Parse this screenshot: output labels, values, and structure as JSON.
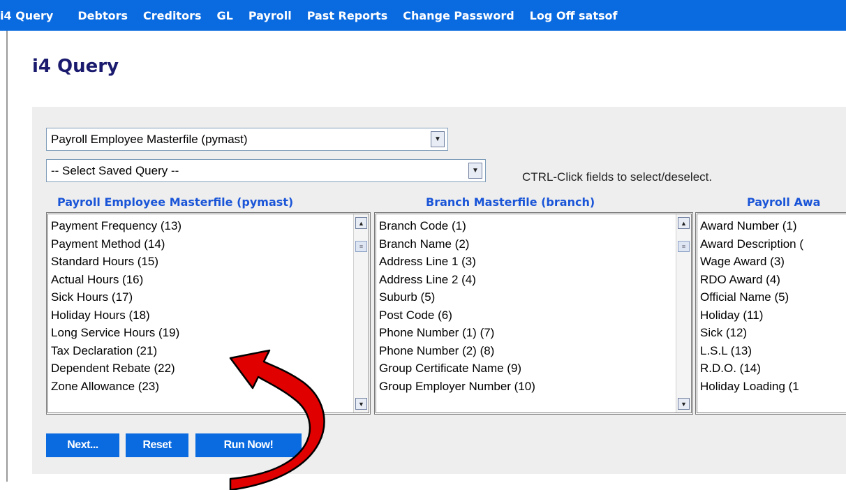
{
  "navbar": {
    "items": [
      "i4 Query",
      "Debtors",
      "Creditors",
      "GL",
      "Payroll",
      "Past Reports",
      "Change Password",
      "Log Off satsof"
    ]
  },
  "page": {
    "title": "i4 Query"
  },
  "query": {
    "table_select": {
      "value": "Payroll Employee Masterfile (pymast)"
    },
    "saved_select": {
      "value": "-- Select Saved Query --"
    },
    "hint": "CTRL-Click fields to select/deselect."
  },
  "columns": [
    {
      "header": "Payroll Employee Masterfile (pymast)",
      "items": [
        "Payment Frequency (13)",
        "Payment Method (14)",
        "Standard Hours (15)",
        "Actual Hours (16)",
        "Sick Hours (17)",
        "Holiday Hours (18)",
        "Long Service Hours (19)",
        "Tax Declaration (21)",
        "Dependent Rebate (22)",
        "Zone Allowance (23)"
      ]
    },
    {
      "header": "Branch Masterfile (branch)",
      "items": [
        "Branch Code (1)",
        "Branch Name (2)",
        "Address Line 1 (3)",
        "Address Line 2 (4)",
        "Suburb (5)",
        "Post Code (6)",
        "Phone Number (1) (7)",
        "Phone Number (2) (8)",
        "Group Certificate Name (9)",
        "Group Employer Number (10)"
      ]
    },
    {
      "header": "Payroll Awa",
      "items": [
        "Award Number (1)",
        "Award Description (",
        "Wage Award (3)",
        "RDO Award (4)",
        "Official Name (5)",
        "Holiday (11)",
        "Sick (12)",
        "L.S.L (13)",
        "R.D.O. (14)",
        "Holiday Loading (1"
      ]
    }
  ],
  "buttons": {
    "next": "Next...",
    "reset": "Reset",
    "run_now": "Run Now!"
  },
  "colors": {
    "nav_bg": "#0a6ae0",
    "title": "#1a1a6e",
    "column_header": "#1a55d8",
    "annotation_arrow": "#e00000"
  },
  "icons": {
    "dropdown": "chevron-down-icon",
    "scroll_up": "scroll-up-icon",
    "scroll_down": "scroll-down-icon"
  }
}
